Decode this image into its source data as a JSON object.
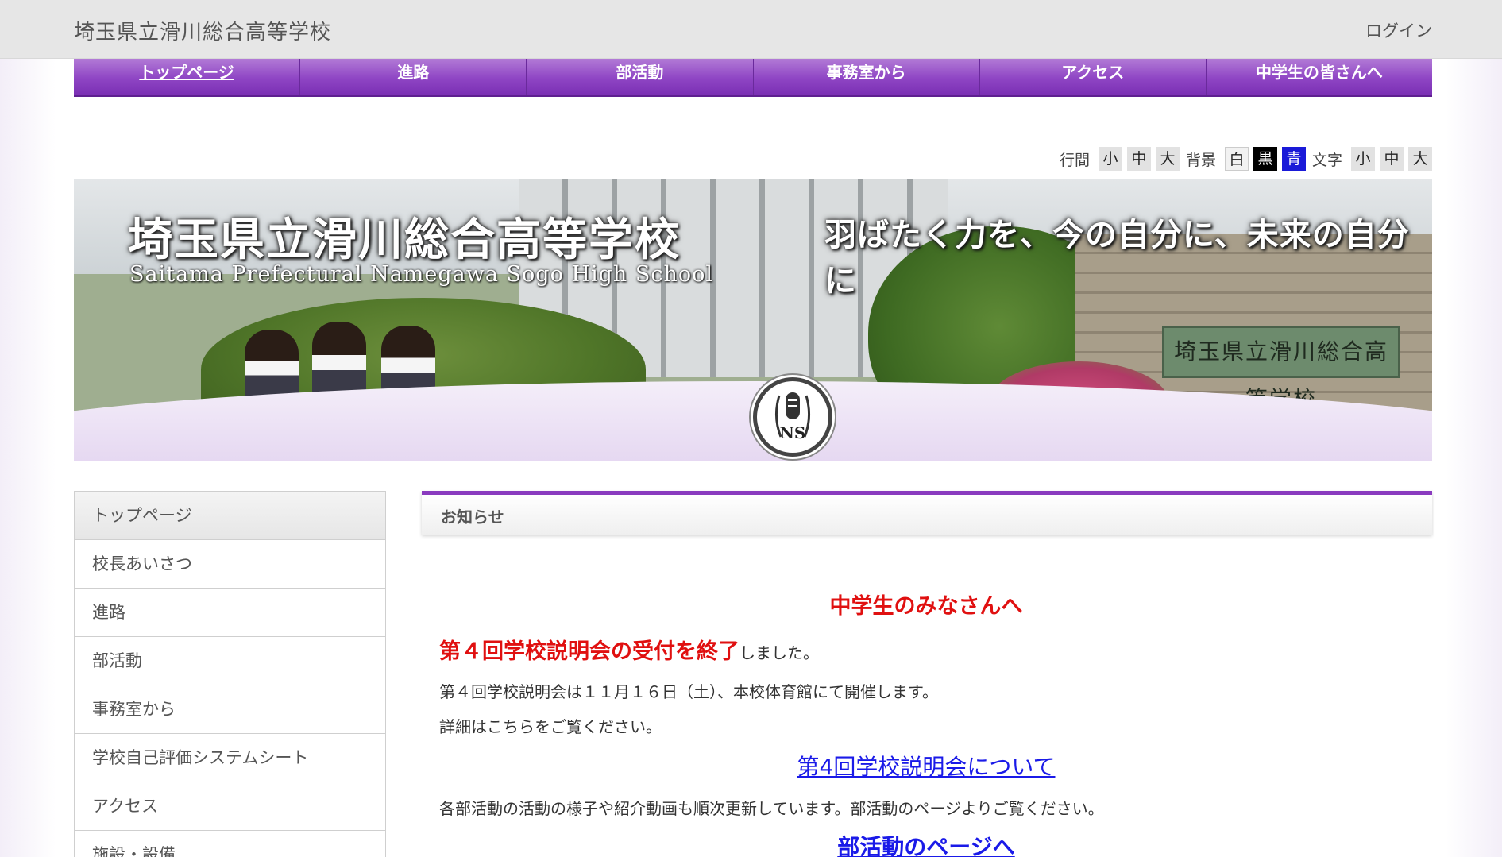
{
  "header": {
    "site_title": "埼玉県立滑川総合高等学校",
    "login": "ログイン"
  },
  "nav": {
    "items": [
      {
        "label": "トップページ"
      },
      {
        "label": "進路"
      },
      {
        "label": "部活動"
      },
      {
        "label": "事務室から"
      },
      {
        "label": "アクセス"
      },
      {
        "label": "中学生の皆さんへ"
      }
    ]
  },
  "accessibility": {
    "line_label": "行間",
    "line_small": "小",
    "line_medium": "中",
    "line_large": "大",
    "bg_label": "背景",
    "bg_white": "白",
    "bg_black": "黒",
    "bg_blue": "青",
    "text_label": "文字",
    "text_small": "小",
    "text_medium": "中",
    "text_large": "大"
  },
  "banner": {
    "title_jp": "埼玉県立滑川総合高等学校",
    "title_en": "Saitama Prefectural Namegawa Sogo High School",
    "slogan": "羽ばたく力を、今の自分に、未来の自分に",
    "plaque": "埼玉県立滑川総合高等学校",
    "emblem_text": "NS"
  },
  "sidebar": {
    "items": [
      {
        "label": "トップページ"
      },
      {
        "label": "校長あいさつ"
      },
      {
        "label": "進路"
      },
      {
        "label": "部活動"
      },
      {
        "label": "事務室から"
      },
      {
        "label": "学校自己評価システムシート"
      },
      {
        "label": "アクセス"
      },
      {
        "label": "施設・設備"
      }
    ]
  },
  "notice": {
    "title": "お知らせ",
    "heading": "中学生のみなさんへ",
    "line1_red": "第４回学校説明会の受付を終了",
    "line1_rest": "しました。",
    "line2": "第４回学校説明会は１１月１６日（土）、本校体育館にて開催します。",
    "line3": "詳細はこちらをご覧ください。",
    "link1": "第4回学校説明会について",
    "line4": "各部活動の活動の様子や紹介動画も順次更新しています。部活動のページよりご覧ください。",
    "link2": "部活動のページへ"
  },
  "colors": {
    "accent_purple": "#8e44c4",
    "alert_red": "#e01010",
    "link_blue": "#1a1ae8"
  }
}
